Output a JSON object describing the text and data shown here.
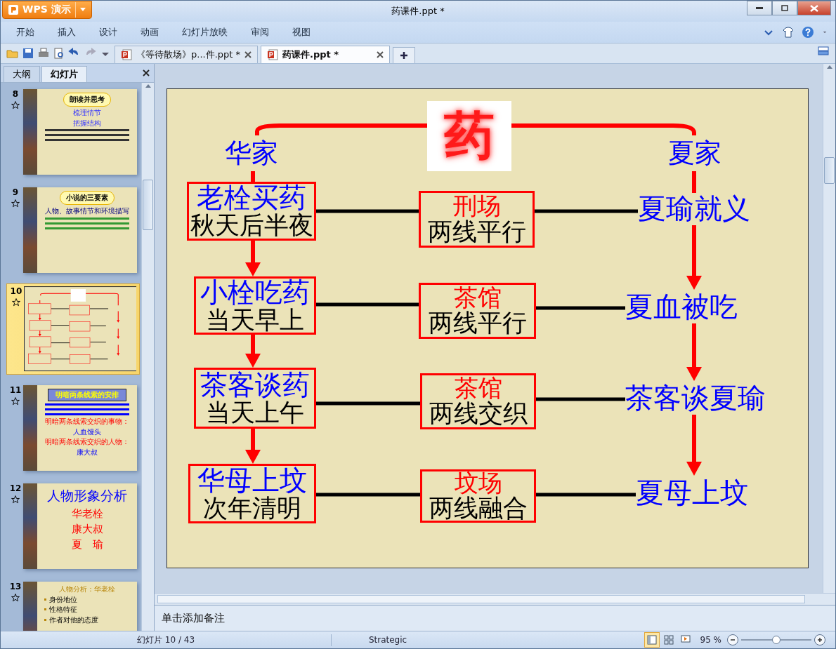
{
  "window": {
    "app_button": "WPS 演示",
    "title": "药课件.ppt *"
  },
  "menu": [
    "开始",
    "插入",
    "设计",
    "动画",
    "幻灯片放映",
    "审阅",
    "视图"
  ],
  "doc_tabs": [
    {
      "label": "《等待散场》p...件.ppt *",
      "selected": false
    },
    {
      "label": "药课件.ppt *",
      "selected": true
    }
  ],
  "panel_tabs": [
    {
      "label": "大纲",
      "selected": false
    },
    {
      "label": "幻灯片",
      "selected": true
    }
  ],
  "thumbnails": [
    {
      "number": "8",
      "selected": false,
      "kind": "text",
      "items": [
        {
          "kind": "cloud",
          "text": "朗读并思考"
        },
        {
          "kind": "subtitle",
          "text": "梳理情节"
        },
        {
          "kind": "subtitle",
          "text": "把握结构"
        },
        {
          "kind": "body-lines"
        }
      ]
    },
    {
      "number": "9",
      "selected": false,
      "kind": "text",
      "items": [
        {
          "kind": "cloud",
          "text": "小说的三要素"
        },
        {
          "kind": "caption",
          "text": "人物、故事情节和环境描写"
        },
        {
          "kind": "list-lines"
        }
      ]
    },
    {
      "number": "10",
      "selected": true,
      "kind": "diagram"
    },
    {
      "number": "11",
      "selected": false,
      "kind": "text",
      "items": [
        {
          "kind": "banner",
          "text": "明暗两条线索的安排"
        },
        {
          "kind": "para-lines"
        },
        {
          "kind": "question",
          "text": "明暗两条线索交织的事物："
        },
        {
          "kind": "answer",
          "text": "人血馒头"
        },
        {
          "kind": "question",
          "text": "明暗两条线索交织的人物："
        },
        {
          "kind": "answer",
          "text": "康大叔"
        }
      ]
    },
    {
      "number": "12",
      "selected": false,
      "kind": "text",
      "items": [
        {
          "kind": "big",
          "text": "人物形象分析"
        },
        {
          "kind": "name",
          "text": "华老栓"
        },
        {
          "kind": "name",
          "text": "康大叔"
        },
        {
          "kind": "name",
          "text": "夏　瑜"
        }
      ]
    },
    {
      "number": "13",
      "selected": false,
      "kind": "text",
      "items": [
        {
          "kind": "heading",
          "text": "人物分析：华老栓"
        },
        {
          "kind": "bullet",
          "text": "身份地位"
        },
        {
          "kind": "bullet",
          "text": "性格特征"
        },
        {
          "kind": "bullet",
          "text": "作者对他的态度"
        }
      ]
    }
  ],
  "slide": {
    "logo": "药",
    "left_family": "华家",
    "right_family": "夏家",
    "rows": [
      {
        "event": "老栓买药",
        "time": "秋天后半夜",
        "place": "刑场",
        "relation": "两线平行",
        "xia_event": "夏瑜就义"
      },
      {
        "event": "小栓吃药",
        "time": "当天早上",
        "place": "茶馆",
        "relation": "两线平行",
        "xia_event": "夏血被吃"
      },
      {
        "event": "茶客谈药",
        "time": "当天上午",
        "place": "茶馆",
        "relation": "两线交织",
        "xia_event": "茶客谈夏瑜"
      },
      {
        "event": "华母上坟",
        "time": "次年清明",
        "place": "坟场",
        "relation": "两线融合",
        "xia_event": "夏母上坟"
      }
    ]
  },
  "notes": {
    "placeholder": "单击添加备注"
  },
  "status_bar": {
    "slide_counter": "幻灯片 10 / 43",
    "theme": "Strategic",
    "views": [
      {
        "kind": "normal",
        "selected": true
      },
      {
        "kind": "sorter",
        "selected": false
      },
      {
        "kind": "show",
        "selected": false
      }
    ],
    "zoom": "95 %",
    "zoom_slider": {
      "level": 0.5
    }
  }
}
